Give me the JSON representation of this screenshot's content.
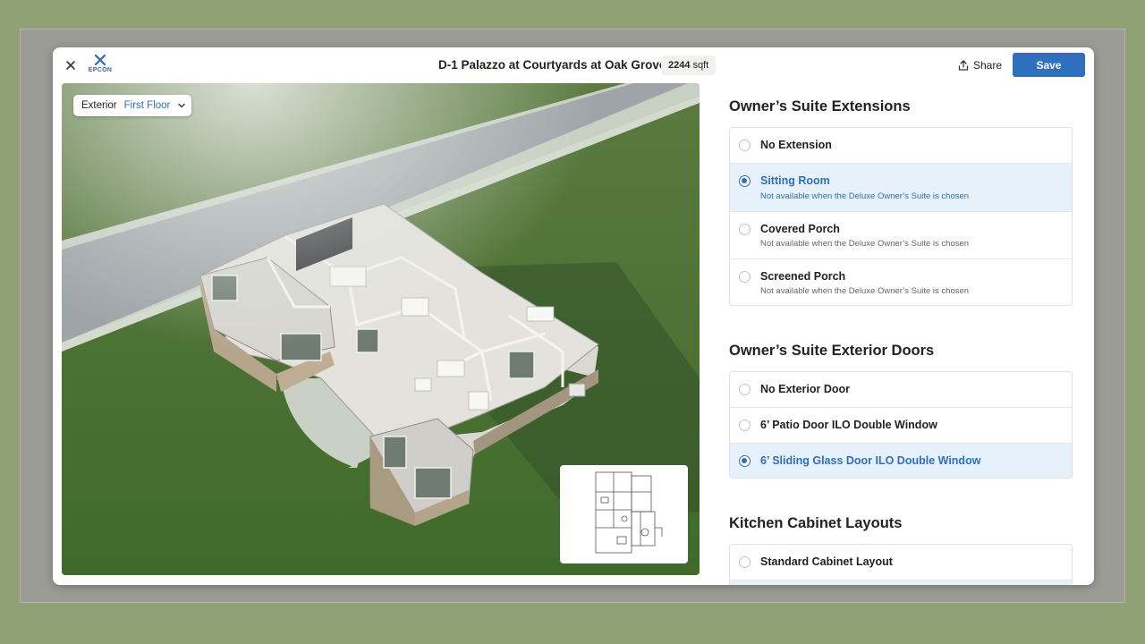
{
  "header": {
    "logo_text": "EPCON",
    "title": "D-1 Palazzo at Courtyards at Oak Grove",
    "sqft_value": "2244",
    "sqft_unit": "sqft",
    "share_label": "Share",
    "save_label": "Save"
  },
  "viewer": {
    "exterior_label": "Exterior",
    "floor_label": "First Floor"
  },
  "sections": [
    {
      "title": "Owner’s Suite Extensions",
      "options": [
        {
          "label": "No Extension",
          "sub": "",
          "selected": false
        },
        {
          "label": "Sitting Room",
          "sub": "Not available when the Deluxe Owner’s Suite is chosen",
          "selected": true
        },
        {
          "label": "Covered Porch",
          "sub": "Not available when the Deluxe Owner’s Suite is chosen",
          "selected": false
        },
        {
          "label": "Screened Porch",
          "sub": "Not available when the Deluxe Owner’s Suite is chosen",
          "selected": false
        }
      ]
    },
    {
      "title": "Owner’s Suite Exterior Doors",
      "options": [
        {
          "label": "No Exterior Door",
          "sub": "",
          "selected": false
        },
        {
          "label": "6’ Patio Door ILO Double Window",
          "sub": "",
          "selected": false
        },
        {
          "label": "6’ Sliding Glass Door ILO Double Window",
          "sub": "",
          "selected": true
        }
      ]
    },
    {
      "title": "Kitchen Cabinet Layouts",
      "options": [
        {
          "label": "Standard Cabinet Layout",
          "sub": "",
          "selected": false
        }
      ]
    }
  ],
  "colors": {
    "accent": "#2f6fbf",
    "selected_bg": "#e7f1fb",
    "page_bg": "#8fa175"
  }
}
